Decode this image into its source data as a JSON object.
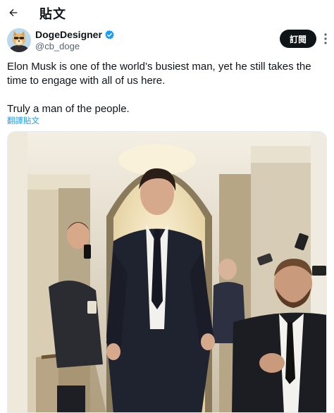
{
  "header": {
    "back_icon": "arrow-left-icon",
    "title": "貼文"
  },
  "author": {
    "display_name": "DogeDesigner",
    "handle": "@cb_doge",
    "verified_icon": "verified-badge-icon",
    "verified_color": "#1d9bf0"
  },
  "actions": {
    "follow_label": "訂閱",
    "more_icon": "more-vertical-icon"
  },
  "tweet": {
    "paragraphs": [
      "Elon Musk is one of the world’s busiest man, yet he still takes the time to engage with all of us here.",
      "Truly a man of the people."
    ],
    "translate_label": "翻譯貼文"
  },
  "colors": {
    "text": "#0f1419",
    "secondary": "#536471",
    "accent": "#1d9bf0",
    "follow_bg": "#0f1419"
  }
}
